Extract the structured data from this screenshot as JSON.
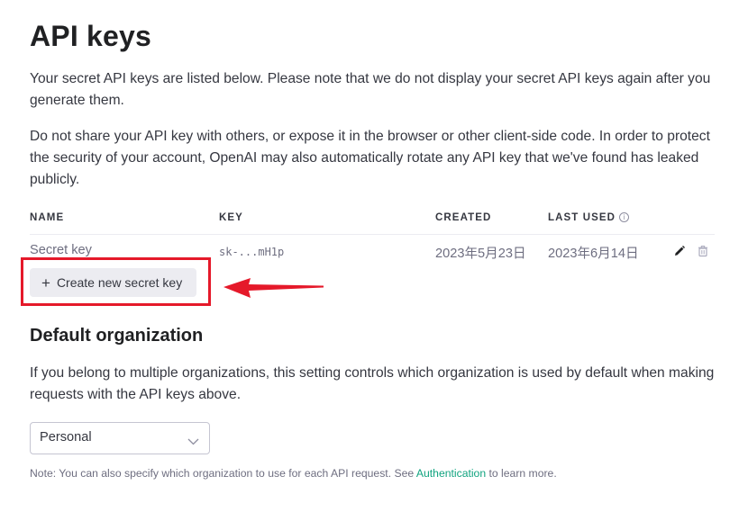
{
  "page": {
    "title": "API keys",
    "intro_1": "Your secret API keys are listed below. Please note that we do not display your secret API keys again after you generate them.",
    "intro_2": "Do not share your API key with others, or expose it in the browser or other client-side code. In order to protect the security of your account, OpenAI may also automatically rotate any API key that we've found has leaked publicly."
  },
  "keys_table": {
    "columns": [
      "NAME",
      "KEY",
      "CREATED",
      "LAST USED"
    ],
    "rows": [
      {
        "name": "Secret key",
        "key": "sk-...mH1p",
        "created": "2023年5月23日",
        "last_used": "2023年6月14日"
      }
    ],
    "icons": {
      "info": "info-icon",
      "edit": "pencil-icon",
      "delete": "trash-icon"
    }
  },
  "create_button": {
    "label": "Create new secret key",
    "icon": "plus-icon"
  },
  "annotation": {
    "highlight_color": "#e5192a"
  },
  "default_org": {
    "heading": "Default organization",
    "description": "If you belong to multiple organizations, this setting controls which organization is used by default when making requests with the API keys above.",
    "select_value": "Personal",
    "note_prefix": "Note: You can also specify which organization to use for each API request. See ",
    "note_link": "Authentication",
    "note_suffix": " to learn more."
  },
  "colors": {
    "link": "#10a37f",
    "button_bg": "#ececf1",
    "text": "#353740"
  }
}
